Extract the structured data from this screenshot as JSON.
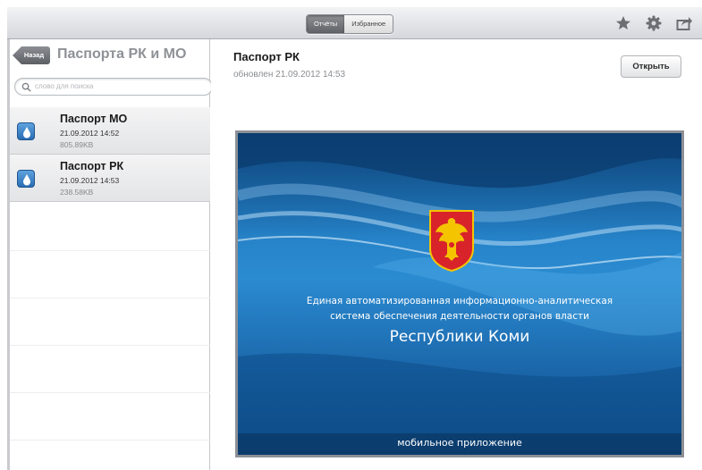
{
  "toolbar": {
    "tabs": [
      {
        "label": "Отчёты",
        "active": true
      },
      {
        "label": "Избранное",
        "active": false
      }
    ],
    "icons": [
      "star-icon",
      "gear-icon",
      "share-icon"
    ]
  },
  "sidebar": {
    "back_label": "Назад",
    "title": "Паспорта РК и МО",
    "search_placeholder": "слово для поиска",
    "items": [
      {
        "name": "Паспорт МО",
        "date": "21.09.2012 14:52",
        "size": "805.89KB"
      },
      {
        "name": "Паспорт РК",
        "date": "21.09.2012 14:53",
        "size": "238.58KB"
      }
    ]
  },
  "detail": {
    "title": "Паспорт РК",
    "updated": "обновлен 21.09.2012 14:53",
    "open_label": "Открыть",
    "cover": {
      "line1": "Единая автоматизированная информационно-аналитическая",
      "line2": "система обеспечения деятельности органов власти",
      "line3": "Республики Коми",
      "footer": "мобильное приложение"
    }
  },
  "colors": {
    "toolbar": "#d4d7dc",
    "cover_blue": "#2b8bd1",
    "emblem_red": "#d8232a",
    "emblem_gold": "#f5c400"
  }
}
